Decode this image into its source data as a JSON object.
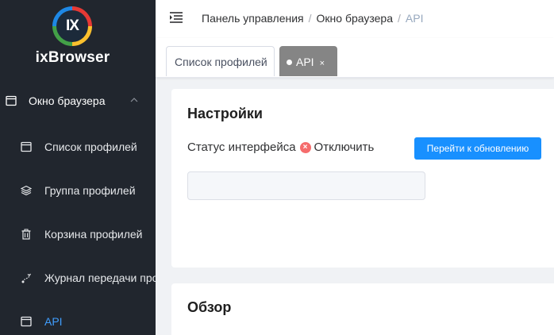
{
  "app": {
    "logo_mark": "IX",
    "name": "ixBrowser"
  },
  "sidebar": {
    "group": {
      "label": "Окно браузера",
      "icon": "window-icon",
      "expanded": true
    },
    "items": [
      {
        "label": "Список профилей",
        "icon": "window-icon"
      },
      {
        "label": "Группа профилей",
        "icon": "layers-icon"
      },
      {
        "label": "Корзина профилей",
        "icon": "trash-icon"
      },
      {
        "label": "Журнал передачи про",
        "icon": "transfer-icon"
      },
      {
        "label": "API",
        "icon": "window-icon",
        "active": true
      }
    ]
  },
  "header": {
    "breadcrumb": [
      "Панель управления",
      "Окно браузера",
      "API"
    ],
    "separator": "/"
  },
  "tabs": [
    {
      "label": "Список профилей",
      "active": false
    },
    {
      "label": "API",
      "active": true,
      "close": "×"
    }
  ],
  "settings": {
    "title": "Настройки",
    "status_label": "Статус интерфейса",
    "status_icon": "×",
    "status_value": "Отключить",
    "update_button": "Перейти к обновлению",
    "input_value": ""
  },
  "overview": {
    "title": "Обзор"
  },
  "colors": {
    "sidebar_bg": "#21262e",
    "accent": "#409eff",
    "button": "#1890ff",
    "error": "#f56c6c",
    "active_tab": "#858585"
  }
}
